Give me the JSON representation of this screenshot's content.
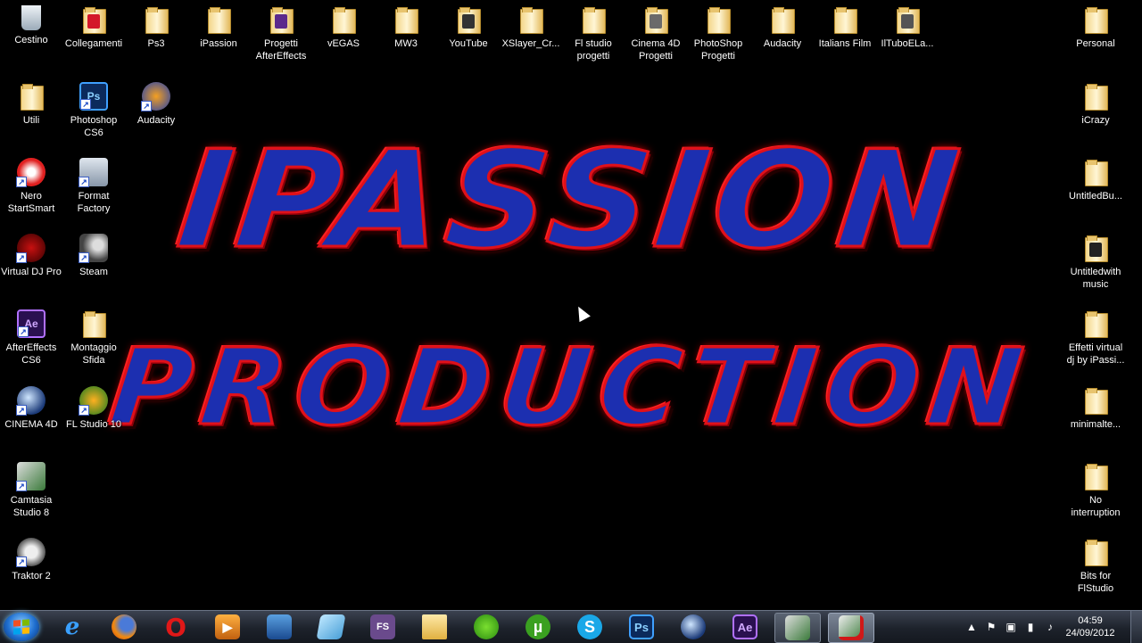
{
  "wallpaper": {
    "line1": "IPASSION",
    "line2": "PRODUCTION"
  },
  "desktop": {
    "icons": [
      {
        "label": "Cestino"
      },
      {
        "label": "Collegamenti"
      },
      {
        "label": "Ps3"
      },
      {
        "label": "iPassion"
      },
      {
        "label": "Progetti AfterEffects"
      },
      {
        "label": "vEGAS"
      },
      {
        "label": "MW3"
      },
      {
        "label": "YouTube"
      },
      {
        "label": "XSlayer_Cr..."
      },
      {
        "label": "Fl studio progetti"
      },
      {
        "label": "Cinema 4D Progetti"
      },
      {
        "label": "PhotoShop Progetti"
      },
      {
        "label": "Audacity"
      },
      {
        "label": "Italians Film"
      },
      {
        "label": "IlTuboELa..."
      },
      {
        "label": "Personal"
      },
      {
        "label": "Utili"
      },
      {
        "label": "Photoshop CS6"
      },
      {
        "label": "Audacity"
      },
      {
        "label": "iCrazy"
      },
      {
        "label": "Nero StartSmart"
      },
      {
        "label": "Format Factory"
      },
      {
        "label": "UntitledBu..."
      },
      {
        "label": "Virtual DJ Pro"
      },
      {
        "label": "Steam"
      },
      {
        "label": "Untitledwith music"
      },
      {
        "label": "AfterEffects CS6"
      },
      {
        "label": "Montaggio Sfida"
      },
      {
        "label": "Effetti virtual dj by iPassi..."
      },
      {
        "label": "CINEMA 4D"
      },
      {
        "label": "FL Studio 10"
      },
      {
        "label": "minimalte..."
      },
      {
        "label": "Camtasia Studio 8"
      },
      {
        "label": "No interruption"
      },
      {
        "label": "Traktor 2"
      },
      {
        "label": "Bits for FlStudio"
      }
    ]
  },
  "taskbar": {
    "buttons": [
      {
        "icon": "internet-explorer-icon",
        "glyph": "e"
      },
      {
        "icon": "firefox-icon",
        "glyph": ""
      },
      {
        "icon": "opera-icon",
        "glyph": "O"
      },
      {
        "icon": "media-player-icon",
        "glyph": "▶"
      },
      {
        "icon": "screen-recorder-icon",
        "glyph": ""
      },
      {
        "icon": "notepad-icon",
        "glyph": ""
      },
      {
        "icon": "fs-app-icon",
        "glyph": "FS"
      },
      {
        "icon": "file-explorer-icon",
        "glyph": ""
      },
      {
        "icon": "parrot-app-icon",
        "glyph": ""
      },
      {
        "icon": "utorrent-icon",
        "glyph": "µ"
      },
      {
        "icon": "skype-icon",
        "glyph": "S"
      },
      {
        "icon": "photoshop-icon",
        "glyph": "Ps"
      },
      {
        "icon": "cinema4d-icon",
        "glyph": ""
      },
      {
        "icon": "aftereffects-icon",
        "glyph": "Ae"
      },
      {
        "icon": "camtasia-icon",
        "glyph": ""
      },
      {
        "icon": "camtasia-recorder-icon",
        "glyph": ""
      }
    ],
    "tray": {
      "time": "04:59",
      "date": "24/09/2012"
    }
  },
  "colors": {
    "wallpaper_fill": "#1c2fb0",
    "wallpaper_outline": "#e0101a",
    "taskbar": "#1d222b"
  }
}
